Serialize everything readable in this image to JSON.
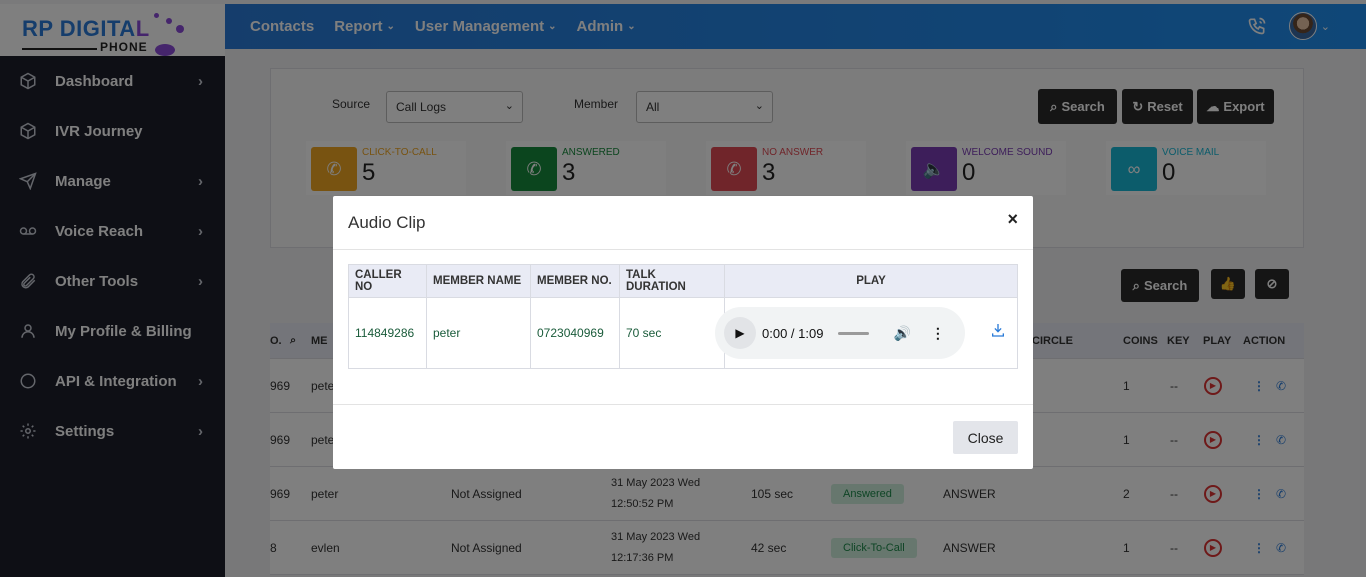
{
  "brand": {
    "name_a": "RP DIGITA",
    "name_b": "L",
    "sub": "PHONE"
  },
  "topnav": [
    {
      "label": "Contacts",
      "chevron": ""
    },
    {
      "label": "Report",
      "chevron": "⌄"
    },
    {
      "label": "User Management",
      "chevron": "⌄"
    },
    {
      "label": "Admin",
      "chevron": "⌄"
    }
  ],
  "sidebar": [
    {
      "label": "Dashboard",
      "icon": "cube-icon",
      "arrow": "›"
    },
    {
      "label": "IVR Journey",
      "icon": "cube-icon",
      "arrow": ""
    },
    {
      "label": "Manage",
      "icon": "send-icon",
      "arrow": "›"
    },
    {
      "label": "Voice Reach",
      "icon": "voicemail-icon",
      "arrow": "›"
    },
    {
      "label": "Other Tools",
      "icon": "paperclip-icon",
      "arrow": "›"
    },
    {
      "label": "My Profile & Billing",
      "icon": "user-icon",
      "arrow": ""
    },
    {
      "label": "API & Integration",
      "icon": "circle-icon",
      "arrow": "›"
    },
    {
      "label": "Settings",
      "icon": "gear-icon",
      "arrow": "›"
    }
  ],
  "filters": {
    "source_label": "Source",
    "source_value": "Call Logs",
    "member_label": "Member",
    "member_value": "All",
    "search": "Search",
    "reset": "Reset",
    "export": "Export"
  },
  "stats": [
    {
      "label": "CLICK-TO-CALL",
      "value": "5",
      "color": "#f0a623"
    },
    {
      "label": "ANSWERED",
      "value": "3",
      "color": "#178a3c"
    },
    {
      "label": "NO ANSWER",
      "value": "3",
      "color": "#e04b55"
    },
    {
      "label": "WELCOME SOUND",
      "value": "0",
      "color": "#7b3cb5"
    },
    {
      "label": "VOICE MAIL",
      "value": "0",
      "color": "#19b8d6"
    }
  ],
  "table_toolbar": {
    "search": "Search"
  },
  "bg_table": {
    "headers": {
      "no": "O.",
      "member": "ME",
      "circle": "CIRCLE",
      "coins": "COINS",
      "key": "KEY",
      "play": "PLAY",
      "action": "ACTION"
    },
    "rows": [
      {
        "no": "969",
        "member": "pete",
        "assigned": "",
        "date": "",
        "time": "",
        "duration": "",
        "status": "",
        "result": "",
        "coins": "1",
        "key": "--"
      },
      {
        "no": "969",
        "member": "pete",
        "assigned": "",
        "date": "",
        "time": "",
        "duration": "",
        "status": "",
        "result": "",
        "coins": "1",
        "key": "--"
      },
      {
        "no": "969",
        "member": "peter",
        "assigned": "Not Assigned",
        "date": "31 May 2023 Wed",
        "time": "12:50:52 PM",
        "duration": "105 sec",
        "status": "Answered",
        "result": "ANSWER",
        "coins": "2",
        "key": "--"
      },
      {
        "no": "8",
        "member": "evlen",
        "assigned": "Not Assigned",
        "date": "31 May 2023 Wed",
        "time": "12:17:36 PM",
        "duration": "42 sec",
        "status": "Click-To-Call",
        "result": "ANSWER",
        "coins": "1",
        "key": "--"
      }
    ]
  },
  "modal": {
    "title": "Audio Clip",
    "close_x": "×",
    "headers": [
      "CALLER NO",
      "MEMBER NAME",
      "MEMBER NO.",
      "TALK DURATION",
      "PLAY"
    ],
    "row": {
      "caller_no": "114849286",
      "member_name": "peter",
      "member_no": "0723040969",
      "talk_duration": "70 sec"
    },
    "player": {
      "time": "0:00 / 1:09",
      "progress": 0
    },
    "close_button": "Close"
  }
}
